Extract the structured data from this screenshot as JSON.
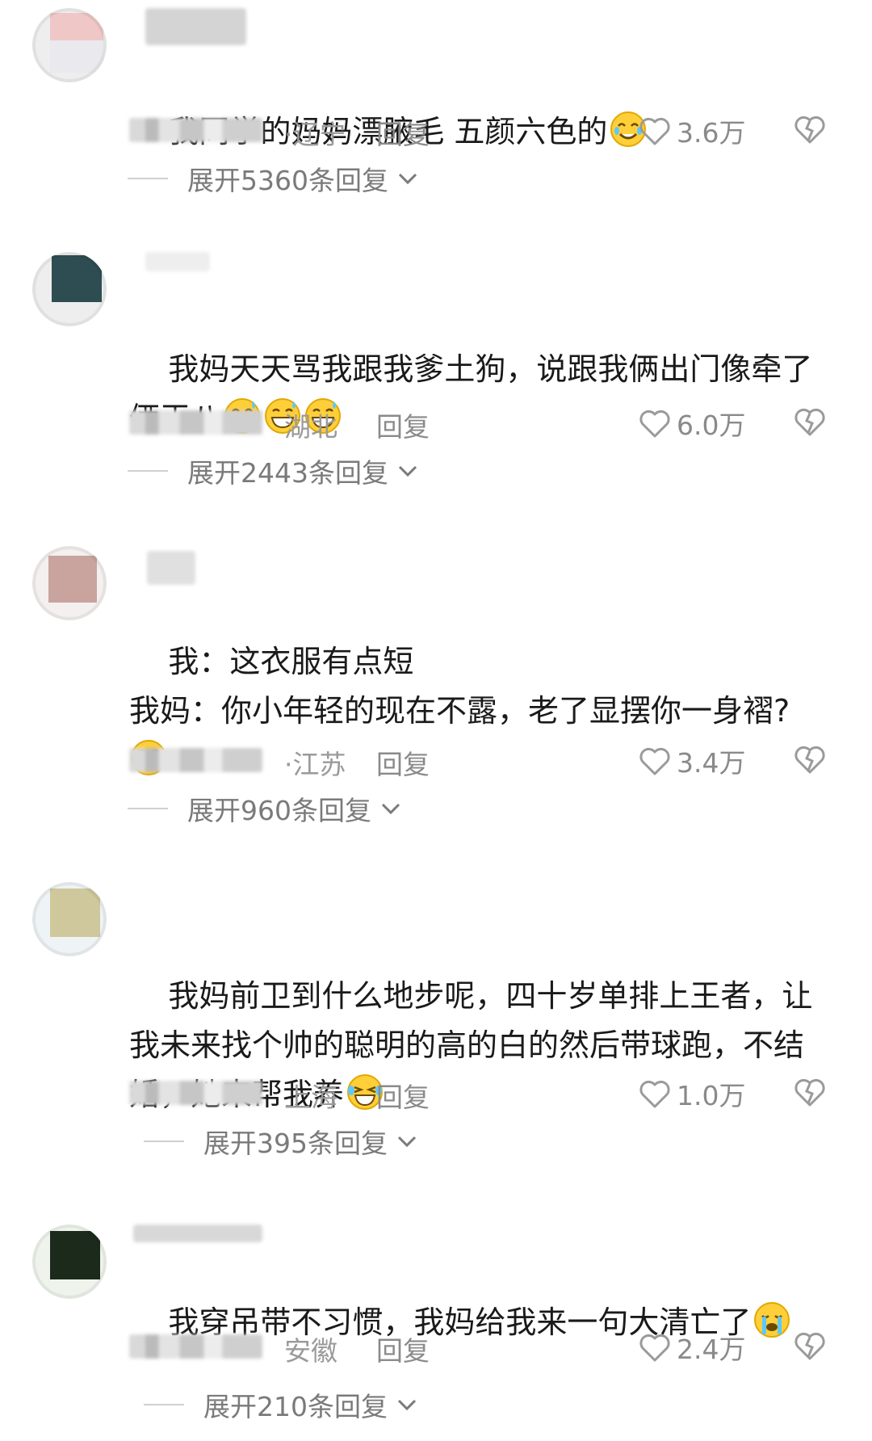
{
  "comments": [
    {
      "text": "我同学的妈妈漂腋毛 五颜六色的",
      "emoji": [
        "tearful-smile-emoji"
      ],
      "location": "·辽宁",
      "reply_label": "回复",
      "likes": "3.6万",
      "expand_label": "展开5360条回复"
    },
    {
      "text": "我妈天天骂我跟我爹土狗，说跟我俩出门像牵了俩王八",
      "emoji": [
        "grin-sweat-emoji",
        "grin-sweat-emoji",
        "grin-sweat-emoji"
      ],
      "location": "湖北",
      "reply_label": "回复",
      "likes": "6.0万",
      "expand_label": "展开2443条回复"
    },
    {
      "text": "我：这衣服有点短\n我妈：你小年轻的现在不露，老了显摆你一身褶?",
      "emoji": [
        "wide-eyed-smile-emoji"
      ],
      "location": "·江苏",
      "reply_label": "回复",
      "likes": "3.4万",
      "expand_label": "展开960条回复"
    },
    {
      "text": "我妈前卫到什么地步呢，四十岁单排上王者，让我未来找个帅的聪明的高的白的然后带球跑，不结婚，她来帮我养",
      "emoji": [
        "laugh-cry-emoji"
      ],
      "location": "上海",
      "reply_label": "回复",
      "likes": "1.0万",
      "expand_label": "展开395条回复"
    },
    {
      "text": "我穿吊带不习惯，我妈给我来一句大清亡了",
      "emoji": [
        "crying-emoji"
      ],
      "location": "安徽",
      "reply_label": "回复",
      "likes": "2.4万",
      "expand_label": "展开210条回复"
    }
  ],
  "colors": {
    "text": "#1a1a1a",
    "meta": "#8a8a8a",
    "location": "#9a9a9a"
  }
}
